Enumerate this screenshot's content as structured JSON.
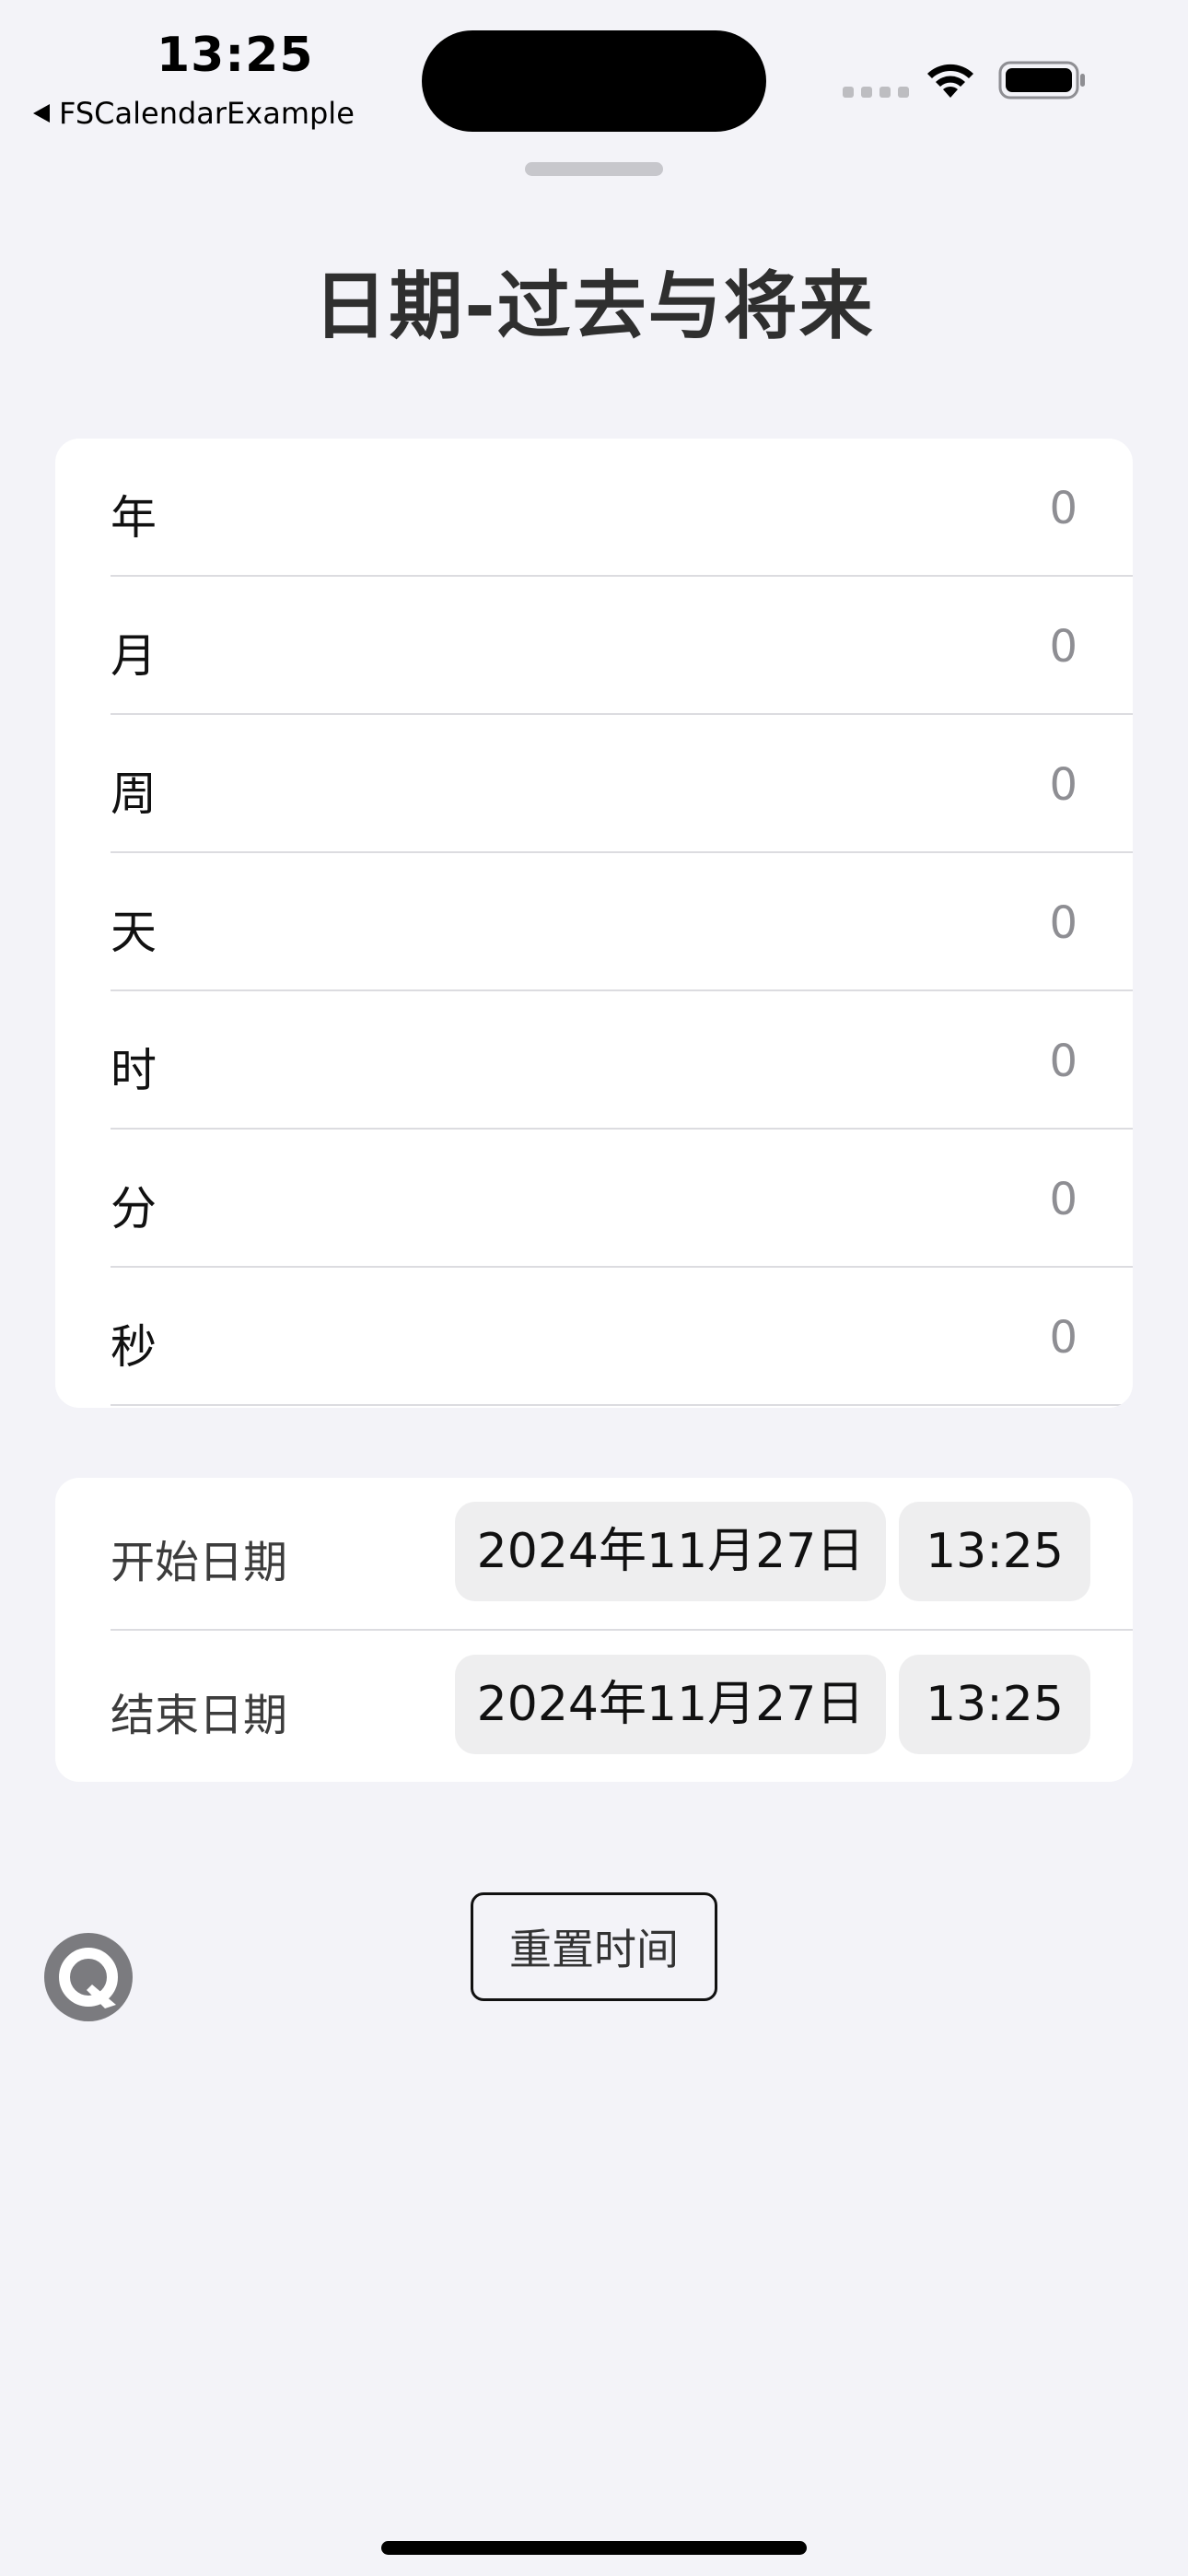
{
  "status_bar": {
    "time": "13:25",
    "back_app": "FSCalendarExample"
  },
  "header": {
    "title": "日期-过去与将来"
  },
  "units": [
    {
      "label": "年",
      "value": "0"
    },
    {
      "label": "月",
      "value": "0"
    },
    {
      "label": "周",
      "value": "0"
    },
    {
      "label": "天",
      "value": "0"
    },
    {
      "label": "时",
      "value": "0"
    },
    {
      "label": "分",
      "value": "0"
    },
    {
      "label": "秒",
      "value": "0"
    }
  ],
  "dates": {
    "start": {
      "label": "开始日期",
      "date": "2024年11月27日",
      "time": "13:25"
    },
    "end": {
      "label": "结束日期",
      "date": "2024年11月27日",
      "time": "13:25"
    }
  },
  "actions": {
    "reset_label": "重置时间"
  },
  "icons": {
    "wifi": "wifi-icon",
    "battery": "battery-icon",
    "assist": "assistive-touch-icon"
  }
}
